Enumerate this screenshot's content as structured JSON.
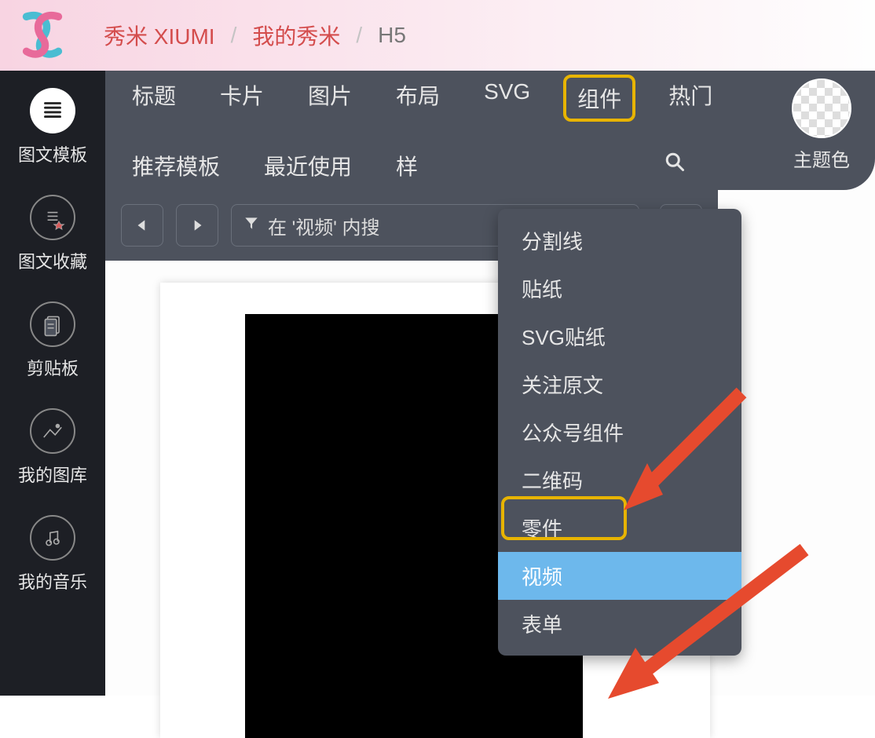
{
  "breadcrumb": {
    "brand": "秀米 XIUMI",
    "mine": "我的秀米",
    "leaf": "H5",
    "sep": "/"
  },
  "sidebar": {
    "items": [
      {
        "label": "图文模板",
        "icon": "template-icon"
      },
      {
        "label": "图文收藏",
        "icon": "favorite-icon"
      },
      {
        "label": "剪贴板",
        "icon": "clipboard-icon"
      },
      {
        "label": "我的图库",
        "icon": "image-library-icon"
      },
      {
        "label": "我的音乐",
        "icon": "music-icon"
      }
    ]
  },
  "tabs": {
    "row": [
      "标题",
      "卡片",
      "图片",
      "布局",
      "SVG",
      "组件",
      "热门",
      "推荐模板",
      "最近使用",
      "样"
    ],
    "highlighted": "组件"
  },
  "theme": {
    "label": "主题色"
  },
  "search": {
    "placeholder": "在 '视频' 内搜"
  },
  "dropdown": {
    "items": [
      "分割线",
      "贴纸",
      "SVG贴纸",
      "关注原文",
      "公众号组件",
      "二维码",
      "零件",
      "视频",
      "表单"
    ],
    "selected": "视频"
  }
}
